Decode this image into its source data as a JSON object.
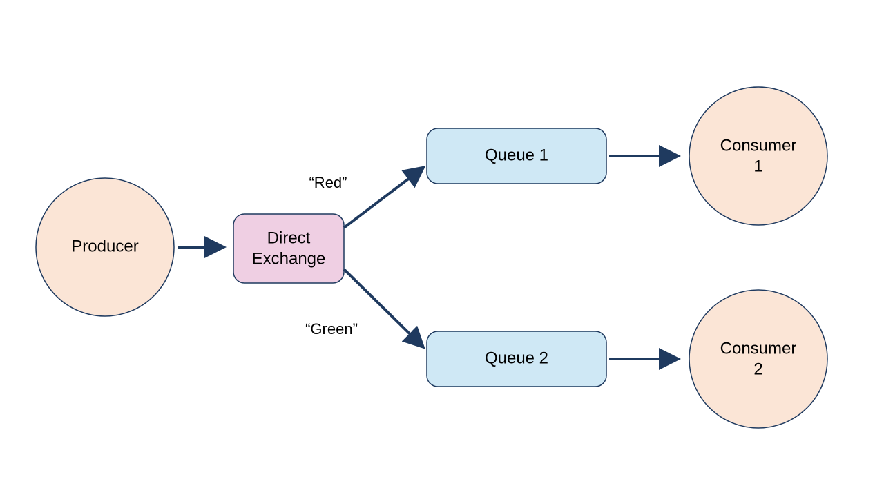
{
  "diagram": {
    "producer": {
      "label": "Producer"
    },
    "exchange": {
      "line1": "Direct",
      "line2": "Exchange"
    },
    "queues": [
      {
        "label": "Queue 1",
        "routing_key": "“Red”"
      },
      {
        "label": "Queue 2",
        "routing_key": "“Green”"
      }
    ],
    "consumers": [
      {
        "line1": "Consumer",
        "line2": "1"
      },
      {
        "line1": "Consumer",
        "line2": "2"
      }
    ]
  },
  "colors": {
    "producer_fill": "#fbe5d6",
    "exchange_fill": "#efcfe3",
    "queue_fill": "#cfe8f5",
    "stroke": "#1f3a5f"
  }
}
